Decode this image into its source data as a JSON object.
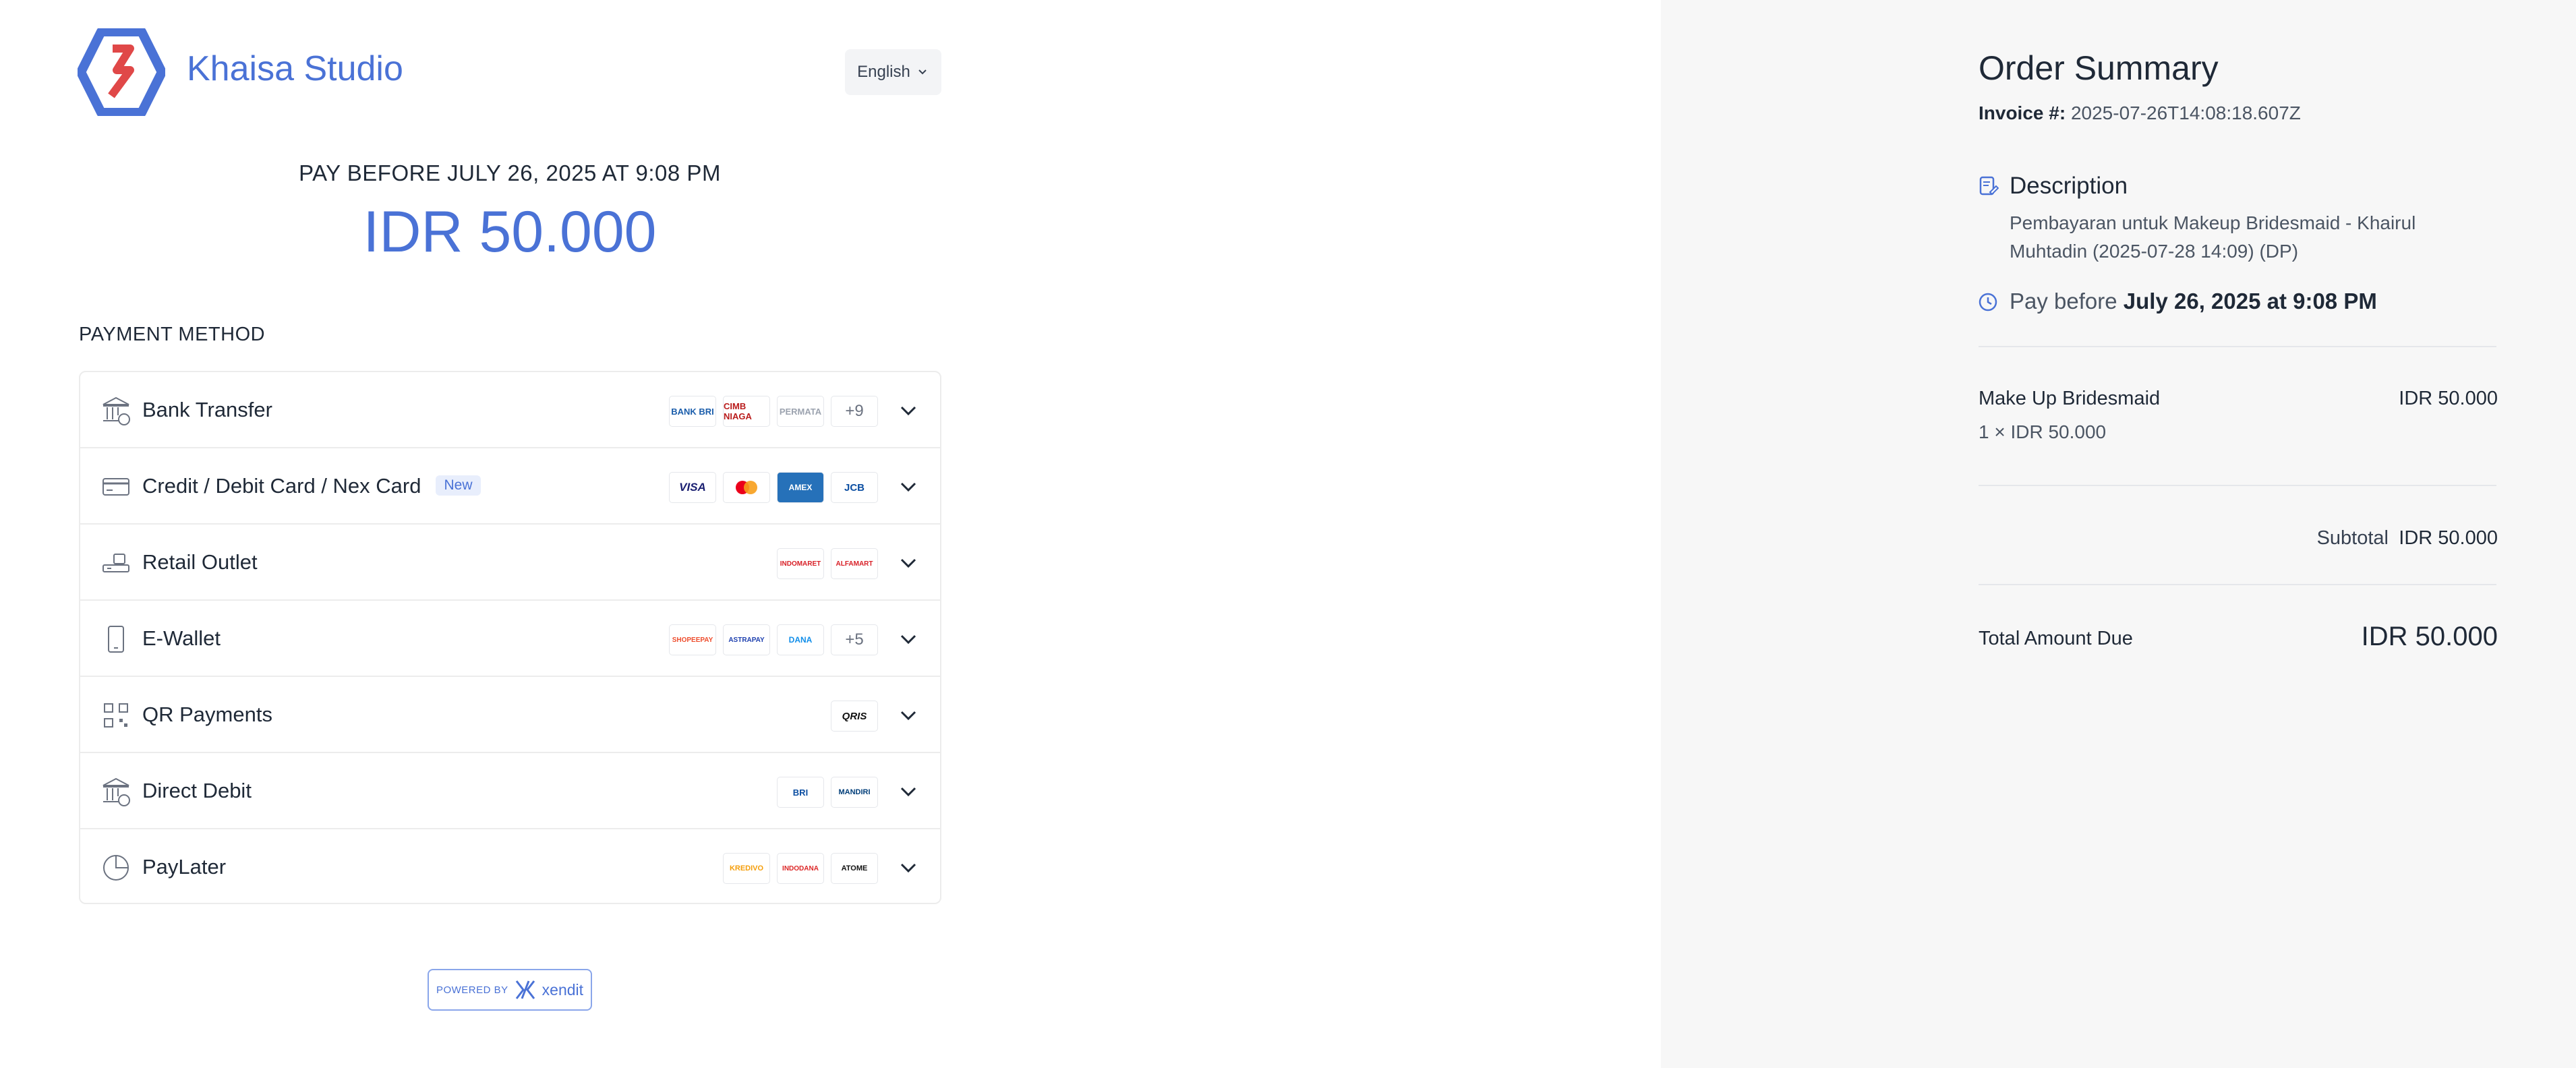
{
  "brand": {
    "name": "Khaisa Studio",
    "accent": "#4a72d6",
    "logo_red": "#e04848"
  },
  "language": {
    "selected": "English"
  },
  "pay_before_heading": "PAY BEFORE JULY 26, 2025 AT 9:08 PM",
  "amount_due": "IDR 50.000",
  "payment_method_label": "PAYMENT METHOD",
  "payment_methods": [
    {
      "name": "Bank Transfer",
      "icon": "bank-icon",
      "logos": [
        "BANK BRI",
        "CIMB NIAGA",
        "PERMATA"
      ],
      "more": "+9"
    },
    {
      "name": "Credit / Debit Card / Nex Card",
      "icon": "card-icon",
      "badge": "New",
      "logos": [
        "VISA",
        "MASTERCARD",
        "AMEX",
        "JCB"
      ]
    },
    {
      "name": "Retail Outlet",
      "icon": "store-icon",
      "logos": [
        "INDOMARET",
        "ALFAMART"
      ]
    },
    {
      "name": "E-Wallet",
      "icon": "phone-icon",
      "logos": [
        "SHOPEEPAY",
        "ASTRAPAY",
        "DANA"
      ],
      "more": "+5"
    },
    {
      "name": "QR Payments",
      "icon": "qr-icon",
      "logos": [
        "QRIS"
      ]
    },
    {
      "name": "Direct Debit",
      "icon": "bank-icon",
      "logos": [
        "BRI",
        "MANDIRI"
      ]
    },
    {
      "name": "PayLater",
      "icon": "pie-chart-icon",
      "logos": [
        "KREDIVO",
        "INDODANA",
        "ATOME"
      ]
    }
  ],
  "powered_by": {
    "prefix": "POWERED BY",
    "provider": "xendit"
  },
  "summary": {
    "title": "Order Summary",
    "invoice_label": "Invoice #:",
    "invoice_value": "2025-07-26T14:08:18.607Z",
    "description_title": "Description",
    "description_text": "Pembayaran untuk Makeup Bridesmaid - Khairul Muhtadin (2025-07-28 14:09) (DP)",
    "pay_before_prefix": "Pay before",
    "pay_before_value": "July 26, 2025 at 9:08 PM",
    "item_name": "Make Up Bridesmaid",
    "item_price": "IDR 50.000",
    "item_qty": "1 × IDR 50.000",
    "subtotal_label": "Subtotal",
    "subtotal_value": "IDR 50.000",
    "total_label": "Total Amount Due",
    "total_value": "IDR 50.000"
  }
}
